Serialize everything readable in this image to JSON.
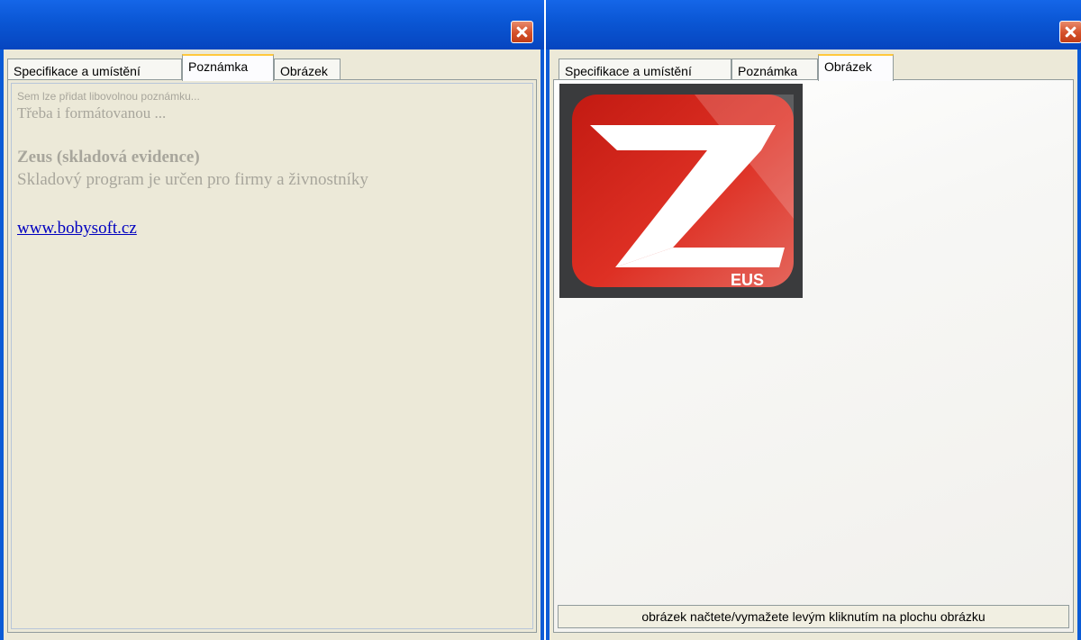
{
  "left_window": {
    "tabs": [
      {
        "label": "Specifikace a umístění"
      },
      {
        "label": "Poznámka"
      },
      {
        "label": "Obrázek"
      }
    ],
    "note": {
      "line1": "Sem lze přidat libovolnou poznámku...",
      "line2": "Třeba i formátovanou ...",
      "heading": "Zeus (skladová evidence)",
      "line3": "Skladový program je určen pro firmy a živnostníky",
      "link": "www.bobysoft.cz"
    }
  },
  "right_window": {
    "tabs": [
      {
        "label": "Specifikace a umístění"
      },
      {
        "label": "Poznámka"
      },
      {
        "label": "Obrázek"
      }
    ],
    "image": {
      "logo_text": "EUS",
      "icon": "zeus-logo-image"
    },
    "status": "obrázek načtete/vymažete levým kliknutím na plochu obrázku"
  },
  "colors": {
    "title_bar": "#0a56d4",
    "close_button": "#d4502a",
    "active_tab_accent": "#ffc83c",
    "link": "#0000c0",
    "logo_red": "#d62a1e"
  }
}
